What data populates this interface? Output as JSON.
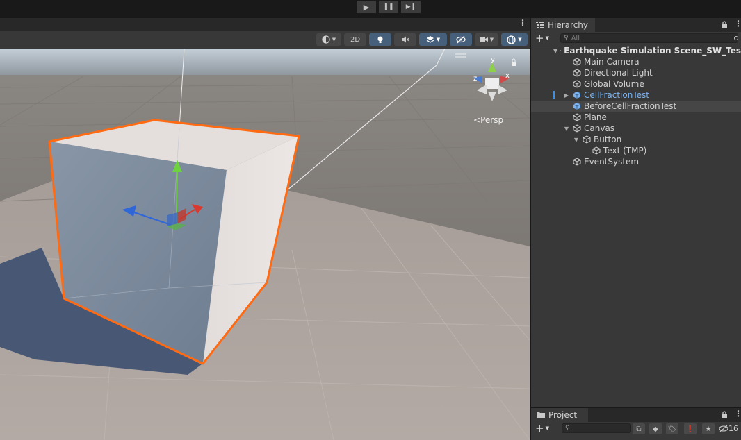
{
  "play_controls": {
    "play_icon": "▶",
    "pause_icon": "❚❚",
    "step_icon": "▶❙"
  },
  "scene_toolbar": {
    "mode_2d": "2D",
    "view_mode_label": "Persp"
  },
  "gizmo": {
    "axis_y": "y",
    "axis_x": "x",
    "axis_z": "z"
  },
  "hierarchy": {
    "tab_label": "Hierarchy",
    "add_label": "+",
    "search_placeholder": "All",
    "scene_name": "Earthquake Simulation Scene_SW_Tes",
    "items": [
      {
        "label": "Main Camera"
      },
      {
        "label": "Directional Light"
      },
      {
        "label": "Global Volume"
      },
      {
        "label": "CellFractionTest"
      },
      {
        "label": "BeforeCellFractionTest"
      },
      {
        "label": "Plane"
      },
      {
        "label": "Canvas"
      },
      {
        "label": "Button"
      },
      {
        "label": "Text (TMP)"
      },
      {
        "label": "EventSystem"
      }
    ]
  },
  "project": {
    "tab_label": "Project",
    "add_label": "+",
    "hidden_count": "16"
  },
  "colors": {
    "selection_outline": "#ff6a12",
    "prefab_blue": "#7cb4f0",
    "panel_bg": "#383838"
  }
}
